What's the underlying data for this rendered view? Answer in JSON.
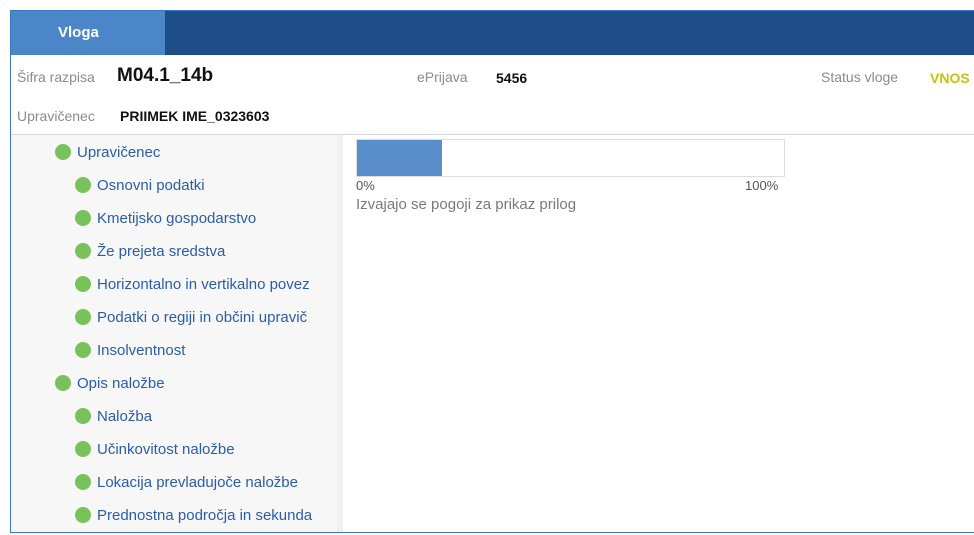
{
  "header": {
    "tab_label": "Vloga"
  },
  "info": {
    "sifra_label": "Šifra razpisa",
    "sifra_value": "M04.1_14b",
    "eprijava_label": "ePrijava",
    "eprijava_value": "5456",
    "status_label": "Status vloge",
    "status_value": "VNOS",
    "upravicenec_label": "Upravičenec",
    "upravicenec_value": "PRIIMEK IME_0323603"
  },
  "tree": [
    {
      "label": "Upravičenec",
      "level": 0
    },
    {
      "label": "Osnovni podatki",
      "level": 1
    },
    {
      "label": "Kmetijsko gospodarstvo",
      "level": 1
    },
    {
      "label": "Že prejeta sredstva",
      "level": 1
    },
    {
      "label": "Horizontalno in vertikalno povez",
      "level": 1
    },
    {
      "label": "Podatki o regiji in občini upravič",
      "level": 1
    },
    {
      "label": "Insolventnost",
      "level": 1
    },
    {
      "label": "Opis naložbe",
      "level": 0
    },
    {
      "label": "Naložba",
      "level": 1
    },
    {
      "label": "Učinkovitost naložbe",
      "level": 1
    },
    {
      "label": "Lokacija prevladujoče naložbe",
      "level": 1
    },
    {
      "label": "Prednostna področja in sekunda",
      "level": 1
    }
  ],
  "progress": {
    "fraction": 0.2,
    "min_label": "0%",
    "max_label": "100%",
    "message": "Izvajajo se pogoji za prikaz prilog"
  },
  "colors": {
    "header_bg": "#1e4e87",
    "tab_bg": "#4a86c8",
    "status": "#c7c20c",
    "dot": "#79c25b",
    "progress": "#5b8fcb"
  },
  "icons": {
    "tree_status": "green-circle-icon"
  }
}
